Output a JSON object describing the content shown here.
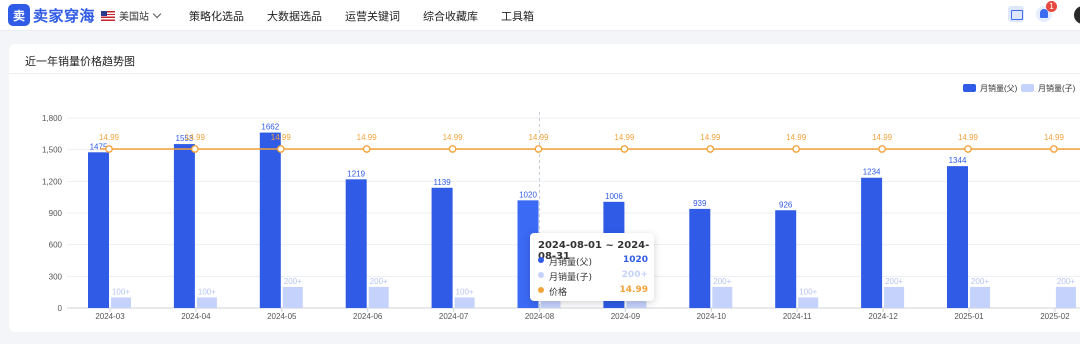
{
  "brand": {
    "logo_glyph": "卖",
    "name": "卖家穿海"
  },
  "site": {
    "label": "美国站"
  },
  "nav": [
    {
      "label": "策略化选品"
    },
    {
      "label": "大数据选品"
    },
    {
      "label": "运营关键词"
    },
    {
      "label": "综合收藏库"
    },
    {
      "label": "工具箱"
    }
  ],
  "notifications": {
    "count": "1"
  },
  "card": {
    "title": "近一年销量价格趋势图"
  },
  "colors": {
    "primary": "#2f5be7",
    "secondary": "#c5d2fb",
    "price": "#f4a23a"
  },
  "chart_data": {
    "type": "bar",
    "categories": [
      "2024-03",
      "2024-04",
      "2024-05",
      "2024-06",
      "2024-07",
      "2024-08",
      "2024-09",
      "2024-10",
      "2024-11",
      "2024-12",
      "2025-01",
      "2025-02"
    ],
    "series": [
      {
        "name": "月销量(父)",
        "values": [
          1475,
          1553,
          1662,
          1219,
          1139,
          1020,
          1006,
          939,
          926,
          1234,
          1344,
          null
        ],
        "labels": [
          "1475",
          "1553",
          "1662",
          "1219",
          "1139",
          "1020",
          "1006",
          "939",
          "926",
          "1234",
          "1344",
          ""
        ]
      },
      {
        "name": "月销量(子)",
        "values": [
          100,
          100,
          200,
          200,
          100,
          100,
          100,
          200,
          100,
          200,
          200,
          200
        ],
        "labels": [
          "100+",
          "100+",
          "200+",
          "200+",
          "100+",
          "100+",
          "100+",
          "200+",
          "100+",
          "200+",
          "200+",
          "200+"
        ]
      }
    ],
    "price": {
      "name": "价格",
      "values": [
        14.99,
        14.99,
        14.99,
        14.99,
        14.99,
        14.99,
        14.99,
        14.99,
        14.99,
        14.99,
        14.99,
        14.99
      ]
    },
    "y_ticks": [
      "1,800",
      "1,500",
      "1,200",
      "900",
      "600",
      "300",
      "0"
    ],
    "ylim": [
      0,
      1800
    ],
    "legend_position": "top-right",
    "grid": true
  },
  "tooltip": {
    "title": "2024-08-01 ~ 2024-08-31",
    "rows": [
      {
        "label": "月销量(父)",
        "value": "1020",
        "color": "#2f5be7"
      },
      {
        "label": "月销量(子)",
        "value": "200+",
        "color": "#c5d2fb"
      },
      {
        "label": "价格",
        "value": "14.99",
        "color": "#f4a23a"
      }
    ]
  }
}
